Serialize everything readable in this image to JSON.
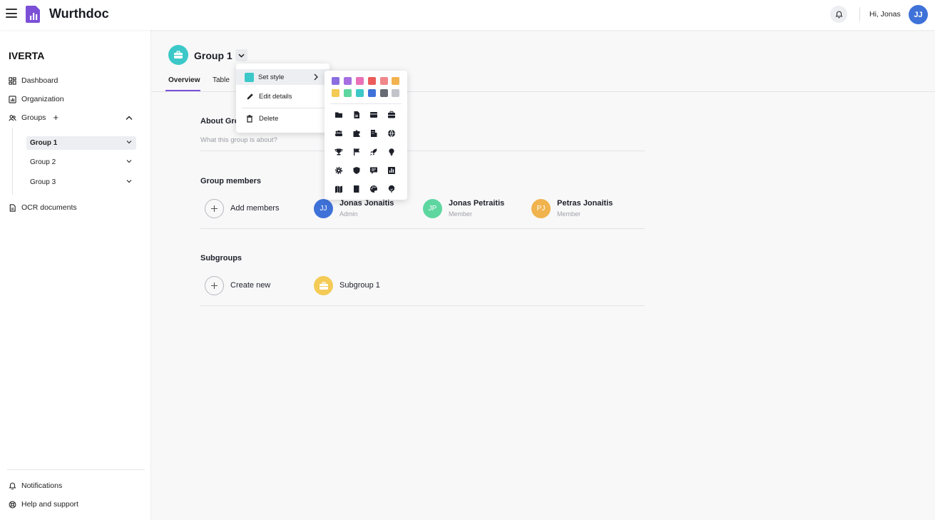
{
  "app": {
    "title": "Wurthdoc",
    "greeting": "Hi, Jonas",
    "user_initials": "JJ"
  },
  "sidebar": {
    "org_name": "IVERTA",
    "nav": {
      "dashboard": "Dashboard",
      "organization": "Organization",
      "groups": "Groups",
      "ocr": "OCR documents"
    },
    "groups": [
      "Group 1",
      "Group 2",
      "Group 3"
    ],
    "footer": {
      "notifications": "Notifications",
      "help": "Help and support"
    }
  },
  "header": {
    "group_title": "Group 1",
    "tabs": [
      "Overview",
      "Table"
    ]
  },
  "about": {
    "title": "About Gro",
    "placeholder": "What this group is about?"
  },
  "members": {
    "title": "Group members",
    "add_label": "Add members",
    "list": [
      {
        "initials": "JJ",
        "name": "Jonas Jonaitis",
        "role": "Admin",
        "color": "#3f72d9"
      },
      {
        "initials": "JP",
        "name": "Jonas Petraitis",
        "role": "Member",
        "color": "#5ed6a0"
      },
      {
        "initials": "PJ",
        "name": "Petras Jonaitis",
        "role": "Member",
        "color": "#f0b34d"
      }
    ]
  },
  "subgroups": {
    "title": "Subgroups",
    "create_label": "Create new",
    "items": [
      {
        "name": "Subgroup 1",
        "color": "#f3cb55"
      }
    ]
  },
  "context_menu": {
    "set_style": "Set style",
    "edit_details": "Edit details",
    "delete": "Delete",
    "current_color": "#3cc8c8"
  },
  "style_picker": {
    "colors": [
      "#8a6ee0",
      "#a66fe0",
      "#ea70b8",
      "#ec5b5b",
      "#f0878a",
      "#f2b24e",
      "#f3cb55",
      "#5ed6a0",
      "#3cc8c8",
      "#3f72d9",
      "#666b74",
      "#c2c4c9"
    ],
    "icons": [
      "folder-icon",
      "document-icon",
      "inbox-icon",
      "briefcase-icon",
      "people-icon",
      "puzzle-icon",
      "building-icon",
      "globe-icon",
      "trophy-icon",
      "flag-icon",
      "rocket-icon",
      "lightbulb-icon",
      "gear-icon",
      "shield-icon",
      "chat-icon",
      "chart-icon",
      "map-icon",
      "book-icon",
      "palette-icon",
      "tree-icon"
    ]
  }
}
